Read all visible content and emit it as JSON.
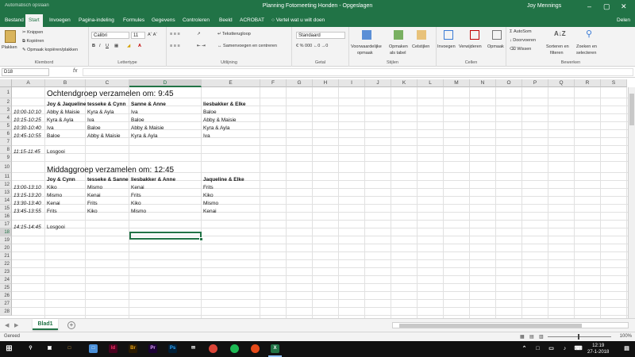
{
  "titlebar": {
    "autosave": "Automatisch opslaan",
    "title": "Planning Fotomeeting Honden  -  Opgeslagen",
    "user": "Joy Mennings"
  },
  "tabs": [
    "Bestand",
    "Start",
    "Invoegen",
    "Pagina-indeling",
    "Formules",
    "Gegevens",
    "Controleren",
    "Beeld",
    "ACROBAT"
  ],
  "tell_me": "Vertel wat u wilt doen",
  "share": "Delen",
  "ribbon": {
    "plakken": "Plakken",
    "knippen": "Knippen",
    "kopieren": "Kopiëren",
    "opmaak_kopieren": "Opmaak kopiëren/plakken",
    "klembord": "Klembord",
    "font": "Calibri",
    "size": "11",
    "lettertype": "Lettertype",
    "tekstterugloop": "Tekstterugloop",
    "samenvoegen": "Samenvoegen en centreren",
    "uitlijning": "Uitlijning",
    "number_format": "Standaard",
    "getal": "Getal",
    "voorwaardelijke1": "Voorwaardelijke",
    "voorwaardelijke2": "opmaak",
    "opmaken1": "Opmaken",
    "opmaken2": "als tabel",
    "celstijlen": "Celstijlen",
    "stijlen": "Stijlen",
    "invoegen": "Invoegen",
    "verwijderen": "Verwijderen",
    "opmaak": "Opmaak",
    "cellen": "Cellen",
    "autosom": "AutoSom",
    "doorvoeren": "Doorvoeren",
    "wissen": "Wissen",
    "sorteren1": "Sorteren en",
    "sorteren2": "filteren",
    "zoeken1": "Zoeken en",
    "zoeken2": "selecteren",
    "bewerken": "Bewerken"
  },
  "namebox": "D18",
  "fx": "fx",
  "columns": [
    "A",
    "B",
    "C",
    "D",
    "E",
    "F",
    "G",
    "H",
    "I",
    "J",
    "K",
    "L",
    "M",
    "N",
    "O",
    "P",
    "Q",
    "R",
    "S"
  ],
  "rows": [
    "1",
    "2",
    "3",
    "4",
    "5",
    "6",
    "7",
    "8",
    "9",
    "10",
    "11",
    "12",
    "13",
    "14",
    "15",
    "16",
    "17",
    "18",
    "19",
    "20",
    "21",
    "22",
    "23",
    "24",
    "25",
    "26",
    "27",
    "28"
  ],
  "cells": {
    "r1": "Ochtendgroep verzamelen om: 9:45",
    "r2": [
      "Joy & Jaqueline",
      "tesseke & Cynn",
      "Sanne & Anne",
      "liesbakker & Elke"
    ],
    "r3": [
      "10:00-10:10",
      "Abby & Maisie",
      "Kyra & Ayla",
      "Iva",
      "Baloe"
    ],
    "r4": [
      "10:15-10:25",
      "Kyra & Ayla",
      "Iva",
      "Baloe",
      "Abby & Maisie"
    ],
    "r5": [
      "10:30-10:40",
      "Iva",
      "Baloe",
      "Abby & Maisie",
      "Kyra & Ayla"
    ],
    "r6": [
      "10:45-10:55",
      "Baloe",
      "Abby & Maisie",
      "Kyra & Ayla",
      "Iva"
    ],
    "r8": [
      "11:15-11:45",
      "Losgooi"
    ],
    "r10": "Middaggroep verzamelen om: 12:45",
    "r11": [
      "Joy & Cynn",
      "tesseke & Sanne",
      "liesbakker & Anne",
      "Jaqueline & Elke"
    ],
    "r12": [
      "13:00-13:10",
      "Kiko",
      "Mismo",
      "Kenai",
      "Frits"
    ],
    "r13": [
      "13:15-13:20",
      "Mismo",
      "Kenai",
      "Frits",
      "Kiko"
    ],
    "r14": [
      "13:30-13:40",
      "Kenai",
      "Frits",
      "Kiko",
      "Mismo"
    ],
    "r15": [
      "13:45-13:55",
      "Frits",
      "Kiko",
      "Mismo",
      "Kenai"
    ],
    "r17": [
      "14:15-14:45",
      "Losgooi"
    ]
  },
  "sheet_tab": "Blad1",
  "status": "Gereed",
  "zoom": "100%",
  "clock": {
    "time": "12:19",
    "date": "27-1-2018"
  },
  "colors": {
    "accent": "#217346"
  }
}
